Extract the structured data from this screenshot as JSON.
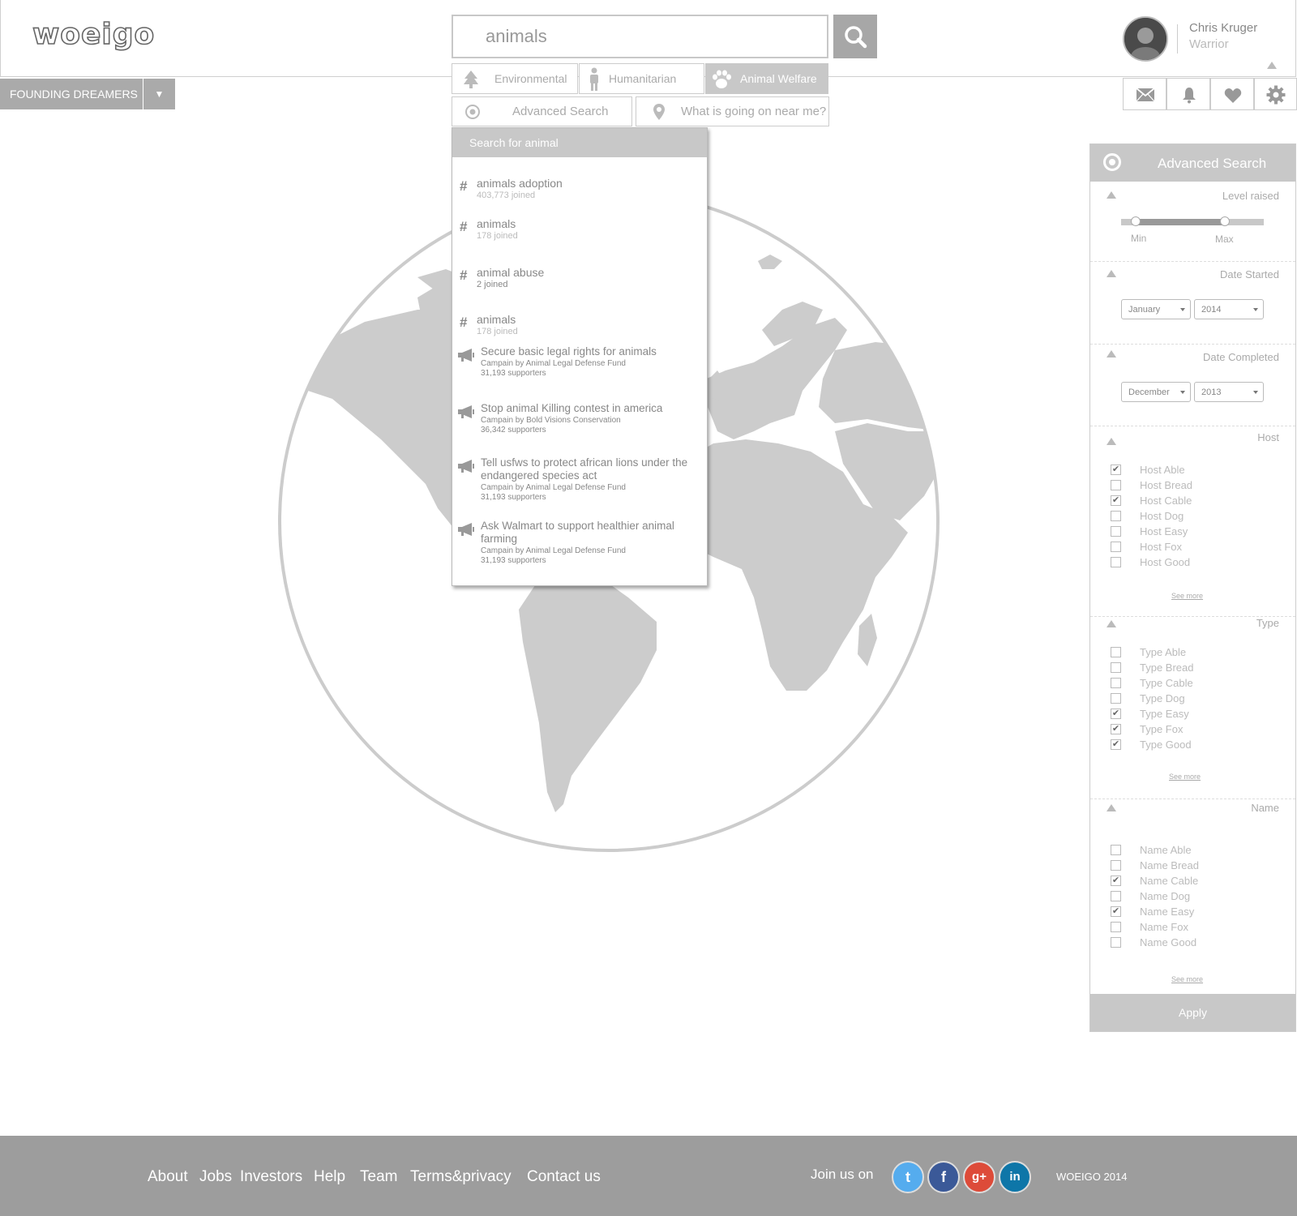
{
  "brand": {
    "logo": "woeigo"
  },
  "search": {
    "query": "animals"
  },
  "categories": [
    {
      "label": "Environmental",
      "icon": "tree-icon",
      "active": false
    },
    {
      "label": "Humanitarian",
      "icon": "person-icon",
      "active": false
    },
    {
      "label": "Animal Welfare",
      "icon": "paw-icon",
      "active": true
    }
  ],
  "subtabs": {
    "advanced": "Advanced Search",
    "nearby": "What is going on near me?"
  },
  "user": {
    "name": "Chris Kruger",
    "role": "Warrior"
  },
  "group_selector": {
    "label": "FOUNDING DREAMERS",
    "arrow": "▼"
  },
  "header_icons": [
    "mail-icon",
    "bell-icon",
    "heart-icon",
    "gear-icon"
  ],
  "dropdown": {
    "heading": "Search for animal",
    "tags": [
      {
        "title": "animals adoption",
        "joined": "403,773 joined"
      },
      {
        "title": "animals",
        "joined": "178 joined"
      },
      {
        "title": "animal abuse",
        "joined": "2 joined"
      },
      {
        "title": "animals",
        "joined": "178 joined"
      }
    ],
    "campaigns": [
      {
        "title": "Secure basic legal rights for animals",
        "by": "Campain by Animal Legal Defense Fund",
        "supporters": "31,193 supporters"
      },
      {
        "title": "Stop animal Killing contest in america",
        "by": "Campain by Bold Visions Conservation",
        "supporters": "36,342 supporters"
      },
      {
        "title": "Tell usfws to protect african lions under the endangered species act",
        "by": "Campain by Animal Legal Defense Fund",
        "supporters": "31,193 supporters"
      },
      {
        "title": "Ask Walmart to support healthier animal farming",
        "by": "Campain by Animal Legal Defense Fund",
        "supporters": "31,193 supporters"
      }
    ]
  },
  "advanced_search": {
    "title": "Advanced Search",
    "level": {
      "title": "Level raised",
      "min_label": "Min",
      "max_label": "Max",
      "min_value": 0.1,
      "max_value": 0.73
    },
    "date_started": {
      "title": "Date Started",
      "month": "January",
      "year": "2014"
    },
    "date_completed": {
      "title": "Date Completed",
      "month": "December",
      "year": "2013"
    },
    "host": {
      "title": "Host",
      "items": [
        {
          "label": "Host Able",
          "checked": true
        },
        {
          "label": "Host Bread",
          "checked": false
        },
        {
          "label": "Host Cable",
          "checked": true
        },
        {
          "label": "Host Dog",
          "checked": false
        },
        {
          "label": "Host Easy",
          "checked": false
        },
        {
          "label": "Host Fox",
          "checked": false
        },
        {
          "label": "Host Good",
          "checked": false
        }
      ],
      "see_more": "See more"
    },
    "type": {
      "title": "Type",
      "items": [
        {
          "label": "Type Able",
          "checked": false
        },
        {
          "label": "Type Bread",
          "checked": false
        },
        {
          "label": "Type Cable",
          "checked": false
        },
        {
          "label": "Type Dog",
          "checked": false
        },
        {
          "label": "Type Easy",
          "checked": true
        },
        {
          "label": "Type Fox",
          "checked": true
        },
        {
          "label": "Type Good",
          "checked": true
        }
      ],
      "see_more": "See more"
    },
    "name": {
      "title": "Name",
      "items": [
        {
          "label": "Name Able",
          "checked": false
        },
        {
          "label": "Name Bread",
          "checked": false
        },
        {
          "label": "Name Cable",
          "checked": true
        },
        {
          "label": "Name Dog",
          "checked": false
        },
        {
          "label": "Name Easy",
          "checked": true
        },
        {
          "label": "Name Fox",
          "checked": false
        },
        {
          "label": "Name Good",
          "checked": false
        }
      ],
      "see_more": "See more"
    },
    "apply": "Apply"
  },
  "footer": {
    "links": [
      "About",
      "Jobs",
      "Investors",
      "Help",
      "Team",
      "Terms&privacy",
      "Contact us"
    ],
    "join": "Join us on",
    "social": [
      {
        "name": "twitter-icon",
        "glyph": "t",
        "color": "#55acee"
      },
      {
        "name": "facebook-icon",
        "glyph": "f",
        "color": "#3b5998"
      },
      {
        "name": "google-plus-icon",
        "glyph": "g+",
        "color": "#dd4b39"
      },
      {
        "name": "linkedin-icon",
        "glyph": "in",
        "color": "#0e76a8"
      }
    ],
    "copyright": "WOEIGO 2014"
  },
  "colors": {
    "panel_gray": "#c8c8c8",
    "footer_gray": "#9d9d9d",
    "map_land": "#cccccc"
  }
}
